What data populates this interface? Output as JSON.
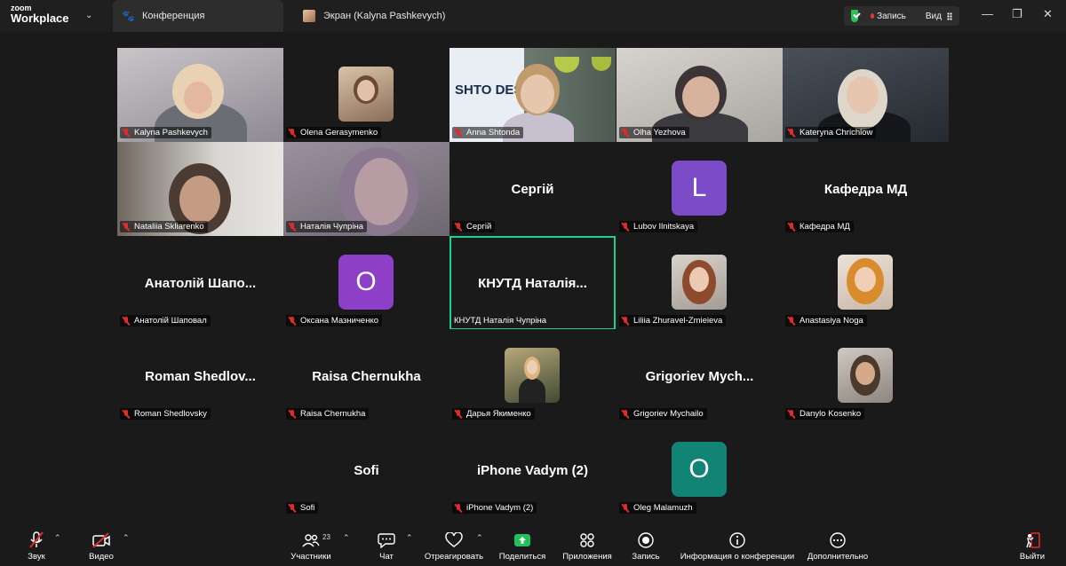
{
  "app": {
    "logo_top": "zoom",
    "logo_bottom": "Workplace"
  },
  "tabs": [
    {
      "label": "Конференция",
      "icon": "paw-icon"
    },
    {
      "label": "Экран (Kalyna Pashkevych)",
      "icon": "avatar-icon"
    }
  ],
  "top_controls": {
    "record": "Запись",
    "view": "Вид"
  },
  "colors": {
    "active_speaker": "#1fcf8d",
    "muted_mic": "#e02b2b",
    "shield": "#2ac15a",
    "letter_L": "#7b4bc8",
    "letter_O_purple": "#8e3fc7",
    "letter_O_teal": "#128476"
  },
  "participants": [
    {
      "name": "Kalyna Pashkevych",
      "kind": "video"
    },
    {
      "name": "Olena Gerasymenko",
      "kind": "thumb"
    },
    {
      "name": "Anna Shtonda",
      "kind": "video",
      "bg_text": "SHTO DESIG"
    },
    {
      "name": "Olha Yezhova",
      "kind": "video"
    },
    {
      "name": "Kateryna Chrichlow",
      "kind": "video"
    },
    {
      "name": "Nataliia Skliarenko",
      "kind": "video"
    },
    {
      "name": "Наталія Чупріна",
      "kind": "video"
    },
    {
      "name": "Сергій",
      "kind": "text",
      "display": "Сергій"
    },
    {
      "name": "Lubov Ilnitskaya",
      "kind": "letter",
      "letter": "L"
    },
    {
      "name": "Кафедра МД",
      "kind": "text",
      "display": "Кафедра МД"
    },
    {
      "name": "Анатолій Шаповал",
      "kind": "text",
      "display": "Анатолій  Шапо..."
    },
    {
      "name": "Оксана Мазниченко",
      "kind": "letter",
      "letter": "O"
    },
    {
      "name": "КНУТД Наталія Чупріна",
      "kind": "text",
      "display": "КНУТД  Наталія..."
    },
    {
      "name": "Liliia Zhuravel-Zmieieva",
      "kind": "thumb"
    },
    {
      "name": "Anastasiya Noga",
      "kind": "thumb"
    },
    {
      "name": "Roman Shedlovsky",
      "kind": "text",
      "display": "Roman  Shedlov..."
    },
    {
      "name": "Raisa Chernukha",
      "kind": "text",
      "display": "Raisa Chernukha"
    },
    {
      "name": "Дарья Якименко",
      "kind": "thumb"
    },
    {
      "name": "Grigoriev Mychailo",
      "kind": "text",
      "display": "Grigoriev  Mych..."
    },
    {
      "name": "Danylo Kosenko",
      "kind": "thumb"
    },
    {
      "name": "Sofi",
      "kind": "text",
      "display": "Sofi"
    },
    {
      "name": "iPhone Vadym (2)",
      "kind": "text",
      "display": "iPhone Vadym (2)"
    },
    {
      "name": "Oleg Malamuzh",
      "kind": "letter",
      "letter": "O"
    }
  ],
  "toolbar": {
    "audio": "Звук",
    "video": "Видео",
    "participants": "Участники",
    "participants_count": "23",
    "chat": "Чат",
    "react": "Отреагировать",
    "share": "Поделиться",
    "apps": "Приложения",
    "record": "Запись",
    "info": "Информация о конференции",
    "more": "Дополнительно",
    "leave": "Выйти"
  }
}
